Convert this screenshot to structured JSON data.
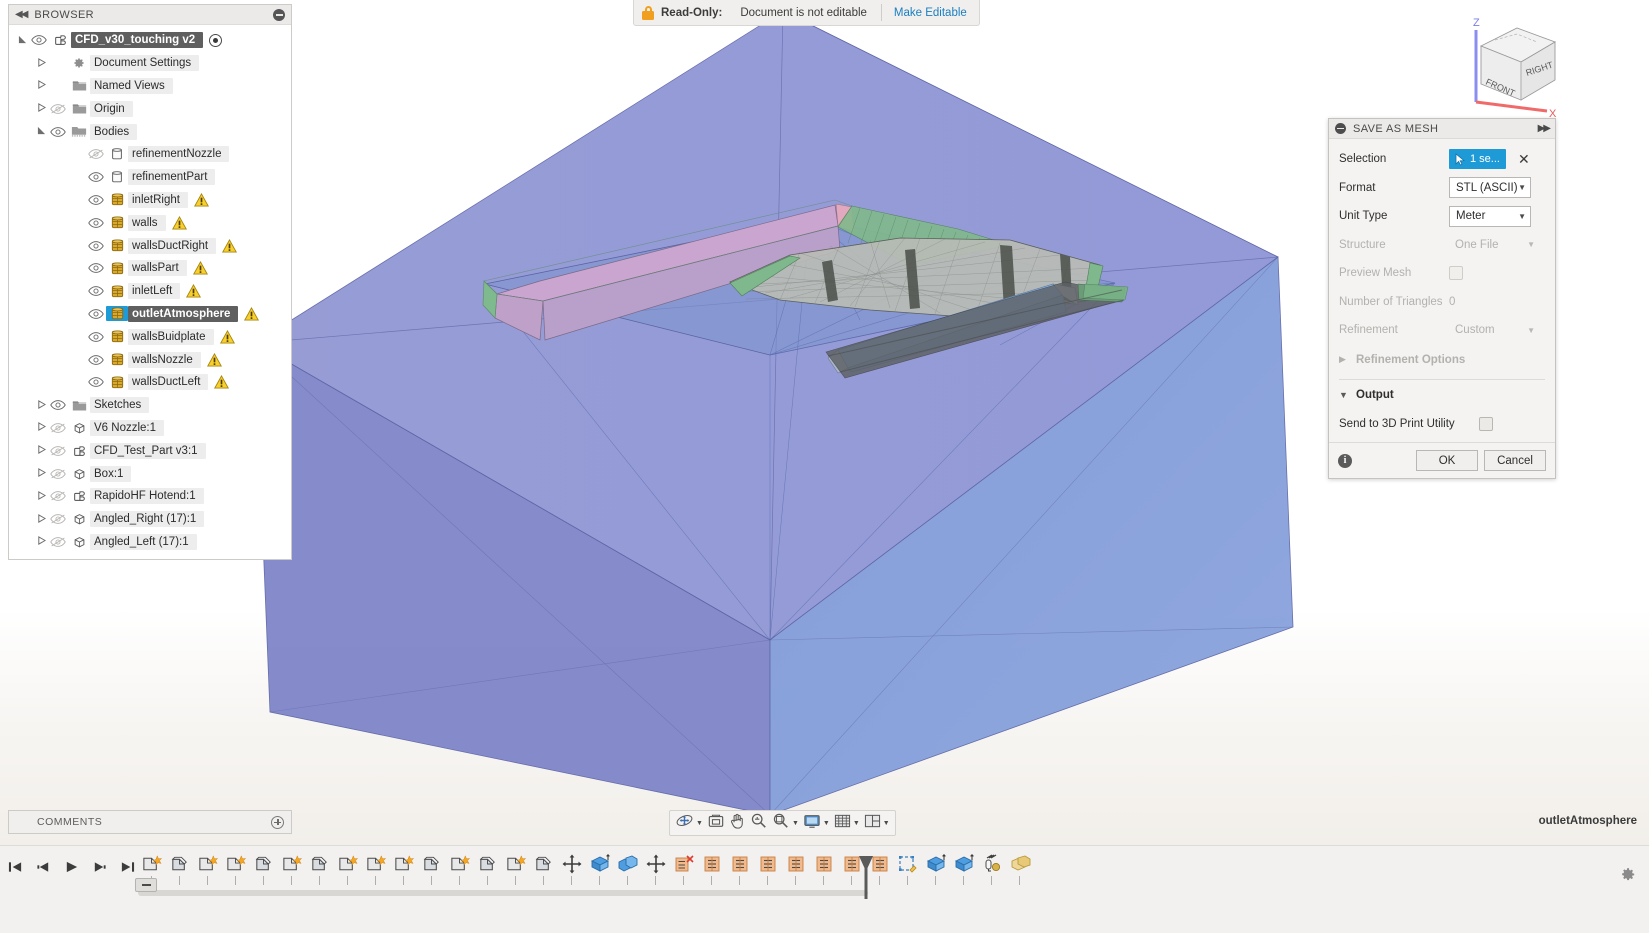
{
  "app": {
    "status_name": "outletAtmosphere"
  },
  "readonly": {
    "icon": "lock-icon",
    "label": "Read-Only:",
    "message": "Document is not editable",
    "action": "Make Editable"
  },
  "viewcube": {
    "axis_z": "Z",
    "axis_x": "X",
    "face_front": "FRONT",
    "face_right": "RIGHT"
  },
  "browser": {
    "title": "BROWSER",
    "collapse_icon": "collapse-left-icon",
    "minimize_icon": "minimize-icon",
    "tree": [
      {
        "label": "CFD_v30_touching v2",
        "icon": "component-icon",
        "indent": 0,
        "arrow": "expanded",
        "eye": "visible",
        "selected": true,
        "radio": true
      },
      {
        "label": "Document Settings",
        "icon": "gear-icon",
        "indent": 1,
        "arrow": "collapsed",
        "eye": "none"
      },
      {
        "label": "Named Views",
        "icon": "folder-icon",
        "indent": 1,
        "arrow": "collapsed",
        "eye": "none"
      },
      {
        "label": "Origin",
        "icon": "folder-icon",
        "indent": 1,
        "arrow": "collapsed",
        "eye": "hidden"
      },
      {
        "label": "Bodies",
        "icon": "bodies-folder-icon",
        "indent": 1,
        "arrow": "expanded",
        "eye": "visible"
      },
      {
        "label": "refinementNozzle",
        "icon": "body-icon",
        "indent": 3,
        "arrow": "none",
        "eye": "hidden"
      },
      {
        "label": "refinementPart",
        "icon": "body-icon",
        "indent": 3,
        "arrow": "none",
        "eye": "visible"
      },
      {
        "label": "inletRight",
        "icon": "mesh-body-icon",
        "indent": 3,
        "arrow": "none",
        "eye": "visible",
        "warning": true
      },
      {
        "label": "walls",
        "icon": "mesh-body-icon",
        "indent": 3,
        "arrow": "none",
        "eye": "visible",
        "warning": true
      },
      {
        "label": "wallsDuctRight",
        "icon": "mesh-body-icon",
        "indent": 3,
        "arrow": "none",
        "eye": "visible",
        "warning": true
      },
      {
        "label": "wallsPart",
        "icon": "mesh-body-icon",
        "indent": 3,
        "arrow": "none",
        "eye": "visible",
        "warning": true
      },
      {
        "label": "inletLeft",
        "icon": "mesh-body-icon",
        "indent": 3,
        "arrow": "none",
        "eye": "visible",
        "warning": true
      },
      {
        "label": "outletAtmosphere",
        "icon": "mesh-body-icon",
        "indent": 3,
        "arrow": "none",
        "eye": "visible",
        "warning": true,
        "selected": true
      },
      {
        "label": "wallsBuidplate",
        "icon": "mesh-body-icon",
        "indent": 3,
        "arrow": "none",
        "eye": "visible",
        "warning": true
      },
      {
        "label": "wallsNozzle",
        "icon": "mesh-body-icon",
        "indent": 3,
        "arrow": "none",
        "eye": "visible",
        "warning": true
      },
      {
        "label": "wallsDuctLeft",
        "icon": "mesh-body-icon",
        "indent": 3,
        "arrow": "none",
        "eye": "visible",
        "warning": true
      },
      {
        "label": "Sketches",
        "icon": "folder-icon",
        "indent": 1,
        "arrow": "collapsed",
        "eye": "visible"
      },
      {
        "label": "V6 Nozzle:1",
        "icon": "box-icon",
        "indent": 1,
        "arrow": "collapsed",
        "eye": "hidden"
      },
      {
        "label": "CFD_Test_Part v3:1",
        "icon": "component-icon",
        "indent": 1,
        "arrow": "collapsed",
        "eye": "hidden"
      },
      {
        "label": "Box:1",
        "icon": "box-icon",
        "indent": 1,
        "arrow": "collapsed",
        "eye": "hidden"
      },
      {
        "label": "RapidoHF Hotend:1",
        "icon": "component-icon",
        "indent": 1,
        "arrow": "collapsed",
        "eye": "hidden"
      },
      {
        "label": "Angled_Right (17):1",
        "icon": "box-icon",
        "indent": 1,
        "arrow": "collapsed",
        "eye": "hidden"
      },
      {
        "label": "Angled_Left (17):1",
        "icon": "box-icon",
        "indent": 1,
        "arrow": "collapsed",
        "eye": "hidden"
      }
    ]
  },
  "comments": {
    "label": "COMMENTS",
    "add_icon": "plus-circle-icon"
  },
  "save_as_mesh": {
    "title": "SAVE AS MESH",
    "collapse_icon": "minimize-icon",
    "pin_icon": "expand-right-icon",
    "fields": [
      {
        "label": "Selection",
        "type": "selection",
        "value": "1 se...",
        "clear": "✕",
        "disabled": false
      },
      {
        "label": "Format",
        "type": "combo",
        "value": "STL (ASCII)",
        "disabled": false
      },
      {
        "label": "Unit Type",
        "type": "combo",
        "value": "Meter",
        "disabled": false
      },
      {
        "label": "Structure",
        "type": "combo",
        "value": "One File",
        "disabled": true
      },
      {
        "label": "Preview Mesh",
        "type": "checkbox",
        "value": "",
        "checked": false,
        "disabled": true
      },
      {
        "label": "Number of Triangles",
        "type": "text",
        "value": "0",
        "disabled": true
      },
      {
        "label": "Refinement",
        "type": "combo",
        "value": "Custom",
        "disabled": true
      }
    ],
    "sections": [
      {
        "label": "Refinement Options",
        "expanded": false,
        "disabled": true
      },
      {
        "label": "Output",
        "expanded": true,
        "disabled": false
      }
    ],
    "output": {
      "label": "Send to 3D Print Utility",
      "checked": false
    },
    "footer": {
      "info_icon": "info-icon",
      "ok": "OK",
      "cancel": "Cancel"
    }
  },
  "nav_toolbar": {
    "items": [
      {
        "name": "orbit-icon",
        "caret": true
      },
      {
        "name": "look-at-icon",
        "caret": false
      },
      {
        "name": "pan-icon",
        "caret": false
      },
      {
        "name": "zoom-icon",
        "caret": false
      },
      {
        "name": "fit-icon",
        "caret": true
      },
      {
        "name": "display-settings-icon",
        "caret": true
      },
      {
        "name": "grid-snap-icon",
        "caret": true
      },
      {
        "name": "viewports-icon",
        "caret": true
      }
    ]
  },
  "timeline": {
    "playback": [
      {
        "name": "go-to-beginning-icon"
      },
      {
        "name": "step-back-icon"
      },
      {
        "name": "play-icon"
      },
      {
        "name": "step-forward-icon"
      },
      {
        "name": "go-to-end-icon"
      }
    ],
    "features": [
      {
        "type": "sketch"
      },
      {
        "type": "body"
      },
      {
        "type": "sketch"
      },
      {
        "type": "sketch"
      },
      {
        "type": "body"
      },
      {
        "type": "sketch"
      },
      {
        "type": "body"
      },
      {
        "type": "sketch"
      },
      {
        "type": "sketch"
      },
      {
        "type": "sketch"
      },
      {
        "type": "body"
      },
      {
        "type": "sketch"
      },
      {
        "type": "body"
      },
      {
        "type": "sketch"
      },
      {
        "type": "body"
      },
      {
        "type": "move"
      },
      {
        "type": "extrude"
      },
      {
        "type": "combine"
      },
      {
        "type": "move"
      },
      {
        "type": "plane-del"
      },
      {
        "type": "plane"
      },
      {
        "type": "plane"
      },
      {
        "type": "plane"
      },
      {
        "type": "plane"
      },
      {
        "type": "plane"
      },
      {
        "type": "plane"
      },
      {
        "type": "plane"
      },
      {
        "type": "sketch-edit"
      },
      {
        "type": "extrude"
      },
      {
        "type": "extrude"
      },
      {
        "type": "thread"
      },
      {
        "type": "appearance"
      }
    ],
    "gear_icon": "settings-gear-icon"
  },
  "colors": {
    "accent_blue": "#1e9bd7",
    "link_blue": "#1a7fc1",
    "warning_yellow": "#f2c21c",
    "lock_orange": "#f0a01e",
    "panel_bg": "#f4f3f1",
    "mesh_purple": "#8a8ecb",
    "mesh_blue": "#7b96d4"
  }
}
